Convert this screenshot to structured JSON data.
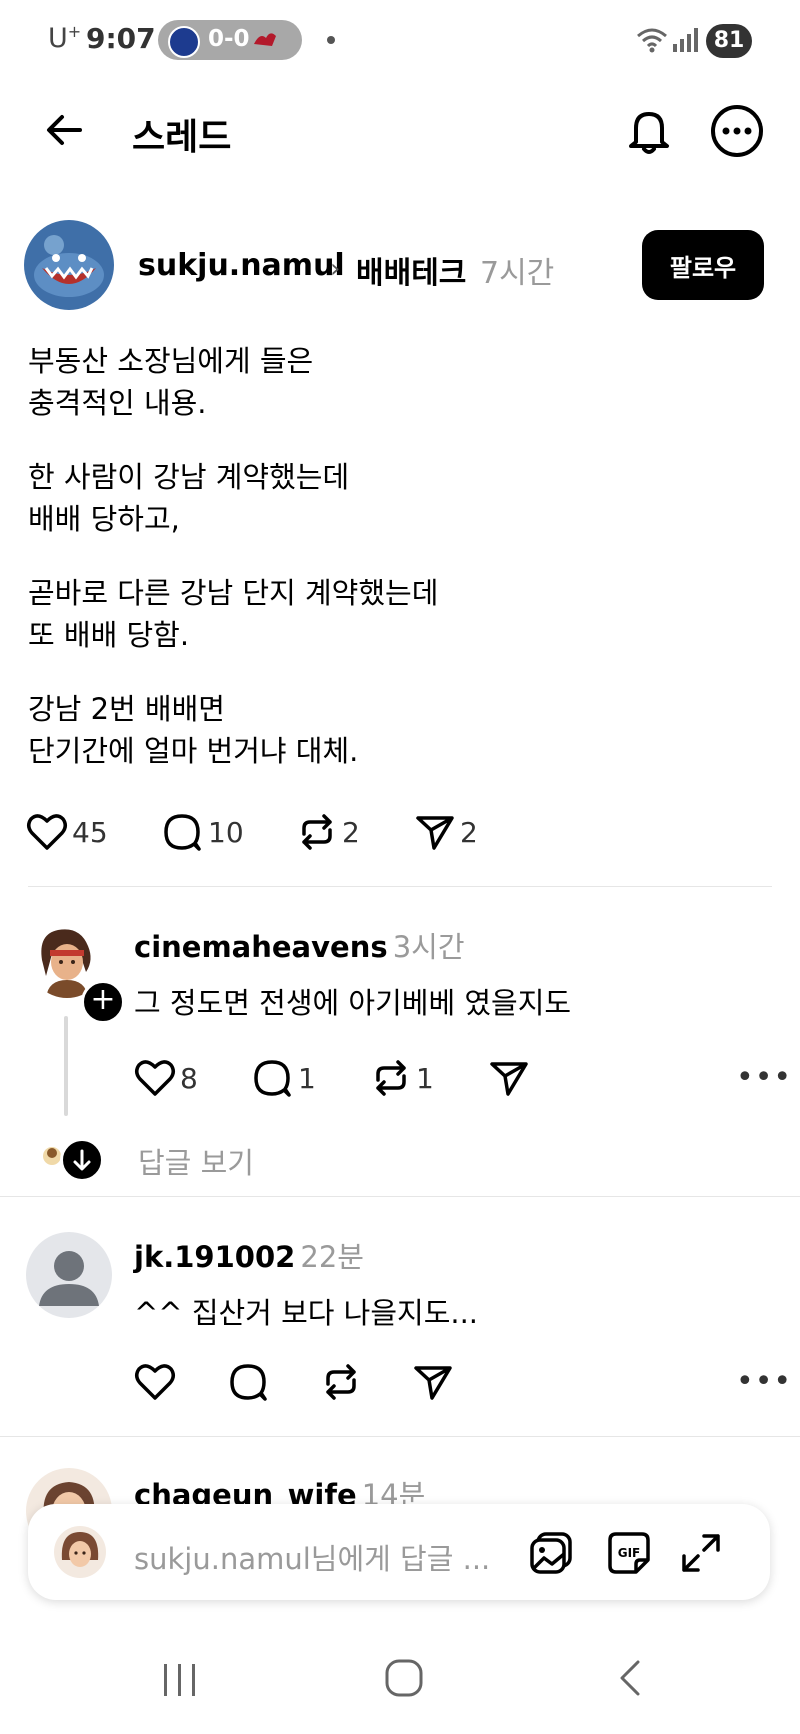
{
  "status_bar": {
    "carrier": "U+",
    "time": "9:07",
    "score": "0-0",
    "battery": "81"
  },
  "header": {
    "title": "스레드"
  },
  "post": {
    "author": "sukju.namul",
    "topic": "배배테크",
    "time": "7시간",
    "follow_label": "팔로우",
    "paragraphs": [
      [
        "부동산 소장님에게 들은",
        "충격적인 내용."
      ],
      [
        "한 사람이 강남 계약했는데",
        "배배 당하고,"
      ],
      [
        "곧바로 다른 강남 단지 계약했는데",
        "또 배배 당함."
      ],
      [
        "강남 2번 배배면",
        "단기간에 얼마 번거냐 대체."
      ]
    ],
    "likes": "45",
    "comments": "10",
    "reposts": "2",
    "shares": "2"
  },
  "comments": [
    {
      "author": "cinemaheavens",
      "time": "3시간",
      "text": "그 정도면 전생에 아기베베 였을지도",
      "likes": "8",
      "replies": "1",
      "reposts": "1",
      "view_replies": "답글 보기"
    },
    {
      "author": "jk.191002",
      "time": "22분",
      "text": "^^ 집산거 보다 나을지도..."
    },
    {
      "author": "chageun_wife",
      "time": "14분"
    }
  ],
  "composer": {
    "placeholder": "sukju.namul님에게 답글 ..."
  },
  "icons": {
    "back": "arrow-left-icon",
    "bell": "bell-icon",
    "more": "more-circle-icon",
    "like": "heart-icon",
    "comment": "comment-icon",
    "repost": "repost-icon",
    "share": "send-icon",
    "image": "image-icon",
    "gif": "gif-icon",
    "expand": "expand-icon"
  }
}
